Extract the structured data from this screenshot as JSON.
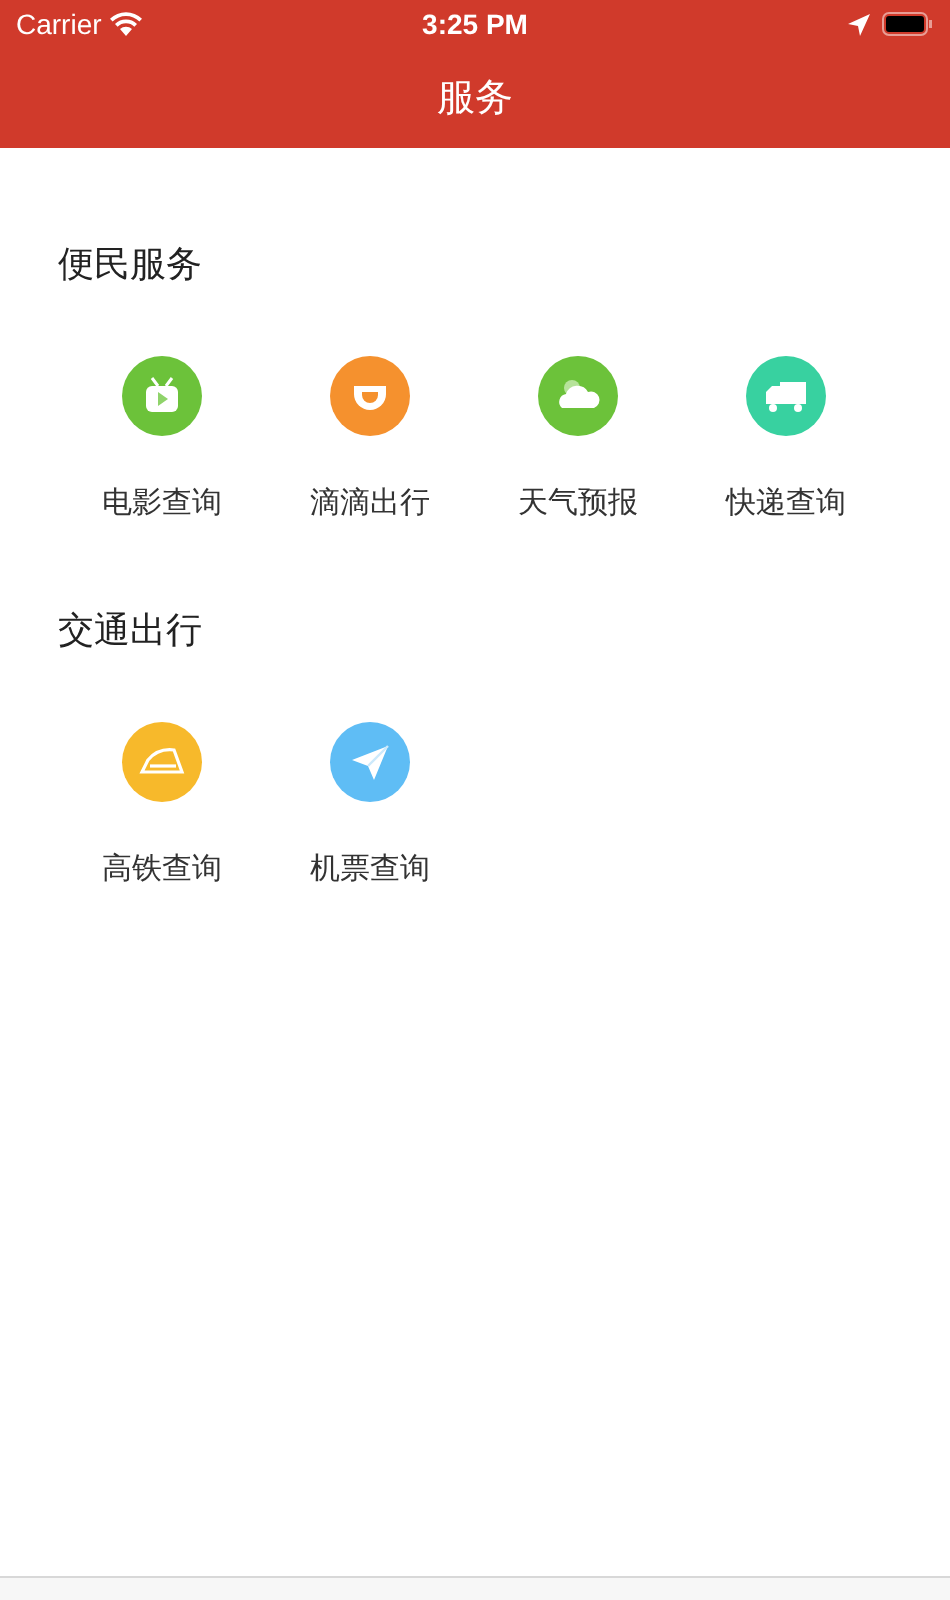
{
  "status_bar": {
    "carrier": "Carrier",
    "time": "3:25 PM"
  },
  "nav_bar": {
    "title": "服务"
  },
  "sections": [
    {
      "title": "便民服务",
      "items": [
        {
          "label": "电影查询",
          "kind": "tv"
        },
        {
          "label": "滴滴出行",
          "kind": "didi"
        },
        {
          "label": "天气预报",
          "kind": "weather"
        },
        {
          "label": "快递查询",
          "kind": "truck"
        }
      ]
    },
    {
      "title": "交通出行",
      "items": [
        {
          "label": "高铁查询",
          "kind": "train"
        },
        {
          "label": "机票查询",
          "kind": "plane"
        }
      ]
    }
  ]
}
